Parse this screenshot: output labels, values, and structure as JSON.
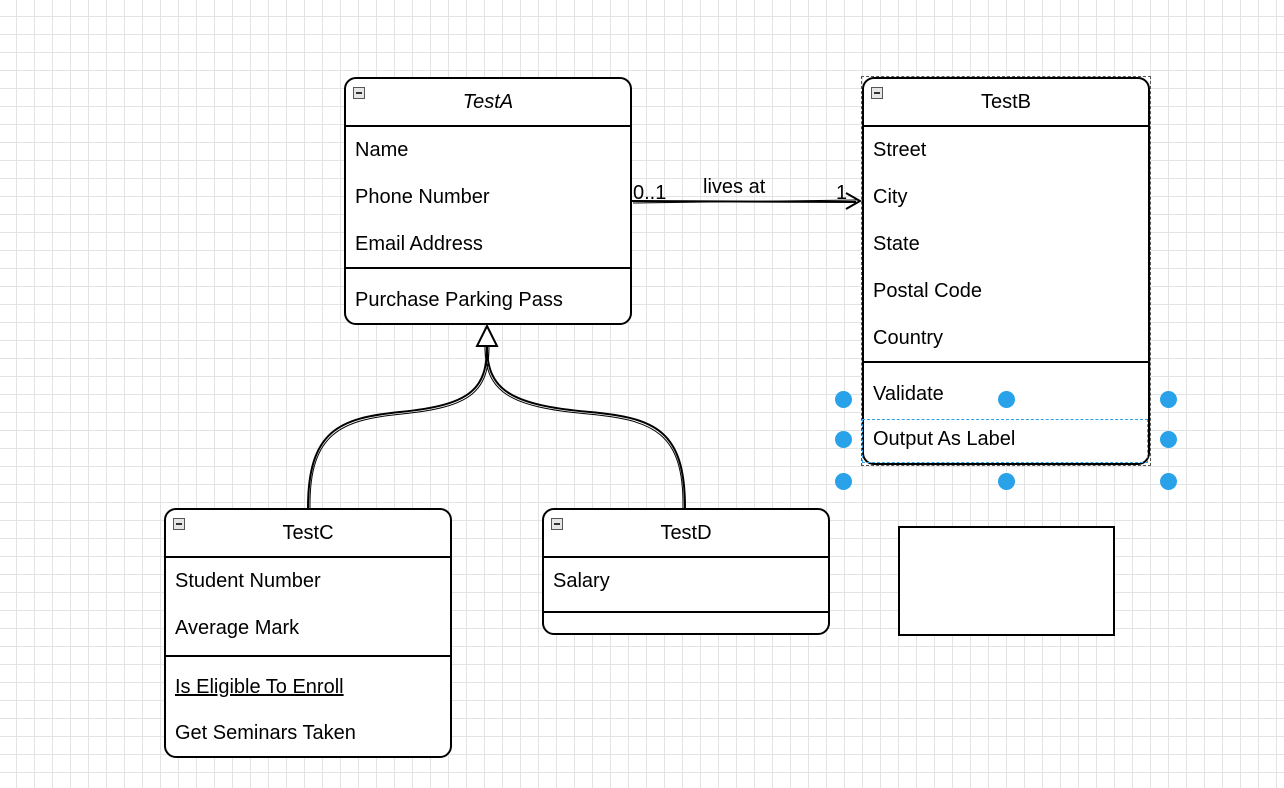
{
  "classes": {
    "testA": {
      "name": "TestA",
      "attributes": [
        "Name",
        "Phone Number",
        "Email Address"
      ],
      "methods": [
        "Purchase Parking Pass"
      ]
    },
    "testB": {
      "name": "TestB",
      "attributes": [
        "Street",
        "City",
        "State",
        "Postal Code",
        "Country"
      ],
      "methods": [
        "Validate",
        "Output As Label"
      ]
    },
    "testC": {
      "name": "TestC",
      "attributes": [
        "Student Number",
        "Average Mark"
      ],
      "methods": [
        "Is Eligible To Enroll",
        "Get Seminars Taken"
      ]
    },
    "testD": {
      "name": "TestD",
      "attributes": [
        "Salary"
      ],
      "methods": []
    }
  },
  "association": {
    "label": "lives at",
    "source_multiplicity": "0..1",
    "target_multiplicity": "1"
  },
  "colors": {
    "selection": "#29a2ea",
    "stroke": "#000000",
    "grid": "#e3e3e3"
  }
}
